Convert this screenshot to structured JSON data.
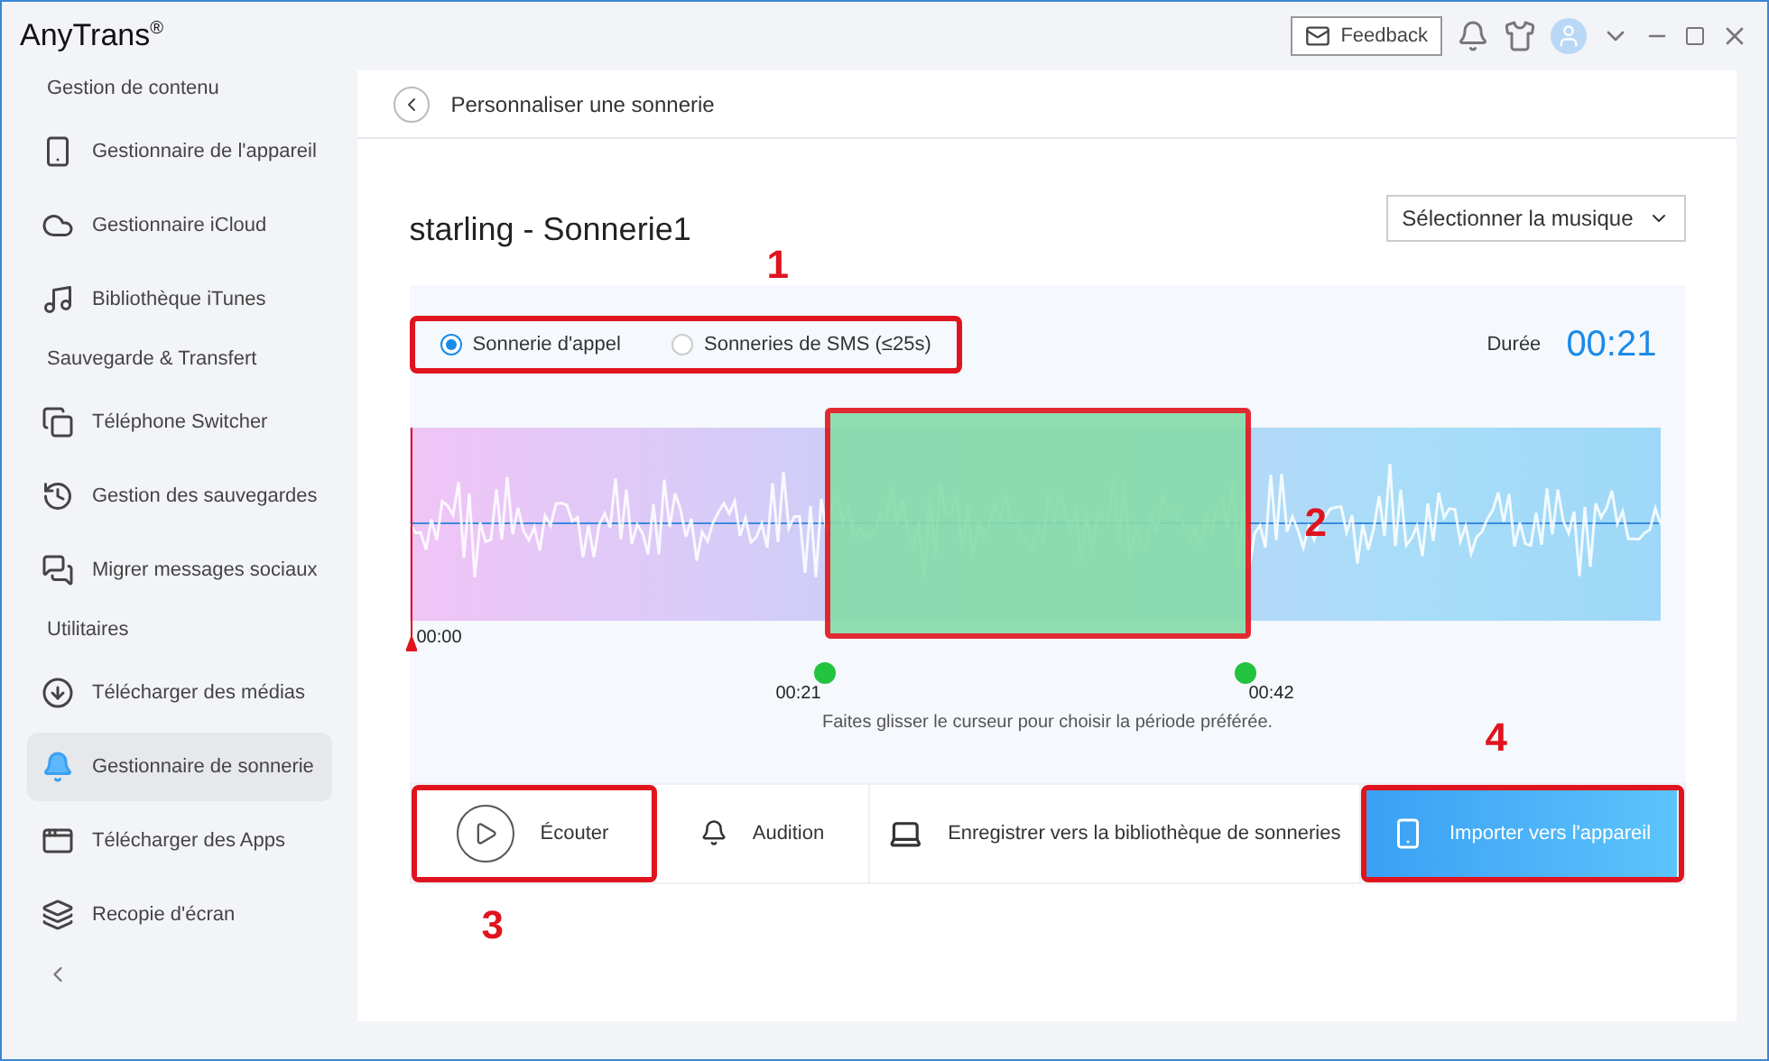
{
  "app": {
    "logo": "AnyTrans$^{®}$",
    "feedback": "Feedback"
  },
  "sidebar": {
    "sections": [
      {
        "title": "Gestion de contenu",
        "items": [
          {
            "label": "Gestionnaire de l'appareil",
            "selected": false
          },
          {
            "label": "Gestionnaire iCloud",
            "selected": false
          },
          {
            "label": "Bibliothèque iTunes",
            "selected": false
          }
        ]
      },
      {
        "title": "Sauvegarde & Transfert",
        "items": [
          {
            "label": "Téléphone Switcher",
            "selected": false
          },
          {
            "label": "Gestion des sauvegardes",
            "selected": false
          },
          {
            "label": "Migrer messages sociaux",
            "selected": false
          }
        ]
      },
      {
        "title": "Utilitaires",
        "items": [
          {
            "label": "Télécharger des médias",
            "selected": false
          },
          {
            "label": "Gestionnaire de sonnerie",
            "selected": true
          },
          {
            "label": "Télécharger des Apps",
            "selected": false
          },
          {
            "label": "Recopie d'écran",
            "selected": false
          }
        ]
      }
    ]
  },
  "page": {
    "header": "Personnaliser une sonnerie",
    "title": "starling - Sonnerie1",
    "select_button": "Sélectionner la musique",
    "modes": {
      "callout": "1",
      "options": [
        {
          "label": "Sonnerie d'appel",
          "selected": true
        },
        {
          "label": "Sonneries de SMS (≤25s)",
          "selected": false
        }
      ]
    },
    "duration_label": "Durée",
    "duration": "00:21",
    "waveform": {
      "playhead": "00:00",
      "selection_callout": "2",
      "start": "00:21",
      "end": "00:42"
    },
    "hint": "Faites glisser le curseur pour choisir la période préférée.",
    "actions": [
      {
        "kind": "listen",
        "label": "Écouter",
        "callout": "3"
      },
      {
        "kind": "audition",
        "label": "Audition"
      },
      {
        "kind": "save",
        "label": "Enregistrer vers la bibliothèque de sonneries"
      },
      {
        "kind": "import",
        "label": "Importer vers l'appareil",
        "callout": "4"
      }
    ]
  }
}
